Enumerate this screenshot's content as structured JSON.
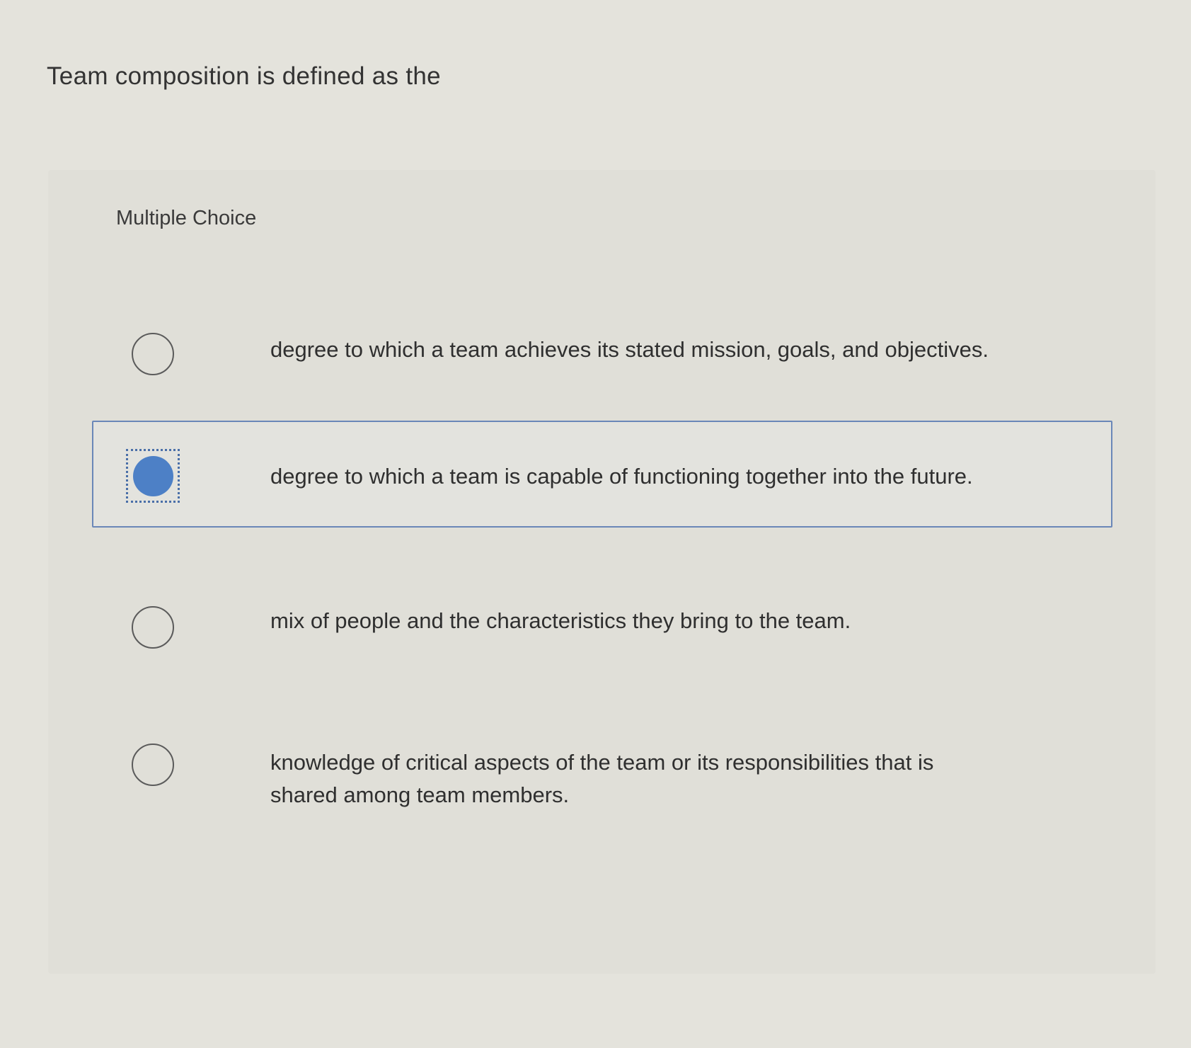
{
  "question": {
    "text": "Team composition is defined as the"
  },
  "panel": {
    "label": "Multiple Choice"
  },
  "options": [
    {
      "text": "degree to which a team achieves its stated mission, goals, and objectives.",
      "selected": false
    },
    {
      "text": "degree to which a team is capable of functioning together into the future.",
      "selected": true
    },
    {
      "text": "mix of people and the characteristics they bring to the team.",
      "selected": false
    },
    {
      "text": "knowledge of critical aspects of the team or its responsibilities that is shared among team members.",
      "selected": false
    }
  ],
  "colors": {
    "selected_radio": "#4d80c6",
    "selected_border": "#6a87b8",
    "background": "#e4e3dc"
  }
}
